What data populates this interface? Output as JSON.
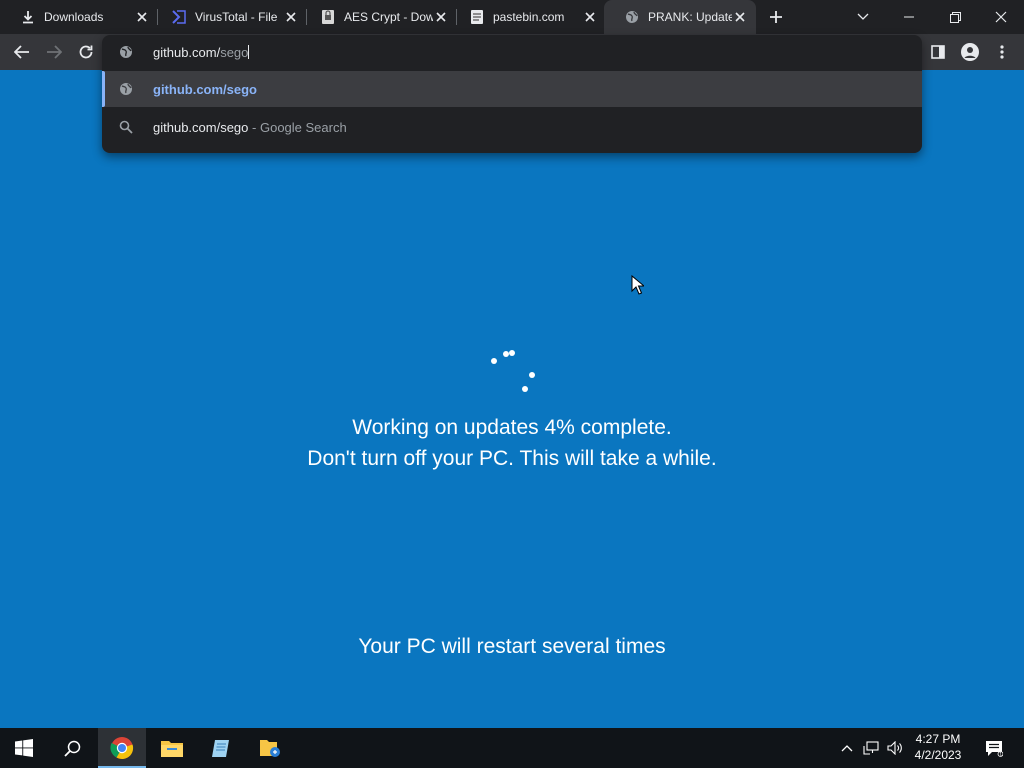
{
  "tabs": [
    {
      "title": "Downloads",
      "icon": "download-icon"
    },
    {
      "title": "VirusTotal - File",
      "icon": "virustotal-icon"
    },
    {
      "title": "AES Crypt - Dow",
      "icon": "aescrypt-icon"
    },
    {
      "title": "pastebin.com",
      "icon": "pastebin-icon"
    },
    {
      "title": "PRANK: Update",
      "icon": "globe-icon",
      "active": true
    }
  ],
  "omnibox": {
    "typed": "github.com/",
    "autocomplete": "sego",
    "suggestions": [
      {
        "icon": "globe-icon",
        "text": "github.com/sego",
        "hint": ""
      },
      {
        "icon": "search-icon",
        "text": "github.com/sego",
        "hint": "- Google Search"
      }
    ]
  },
  "page": {
    "line1": "Working on updates  4% complete.",
    "line2": "Don't turn off your PC. This will take a while.",
    "footer": "Your PC will restart several times",
    "progress_percent": 4
  },
  "taskbar": {
    "time": "4:27 PM",
    "date": "4/2/2023",
    "apps": [
      "start-icon",
      "search-icon",
      "chrome-icon",
      "file-explorer-icon",
      "notepad-icon",
      "folder-app-icon"
    ]
  },
  "colors": {
    "page_bg": "#0a76c0",
    "chrome_dark": "#202124",
    "toolbar": "#35363a",
    "link_blue": "#8ab4f8"
  }
}
